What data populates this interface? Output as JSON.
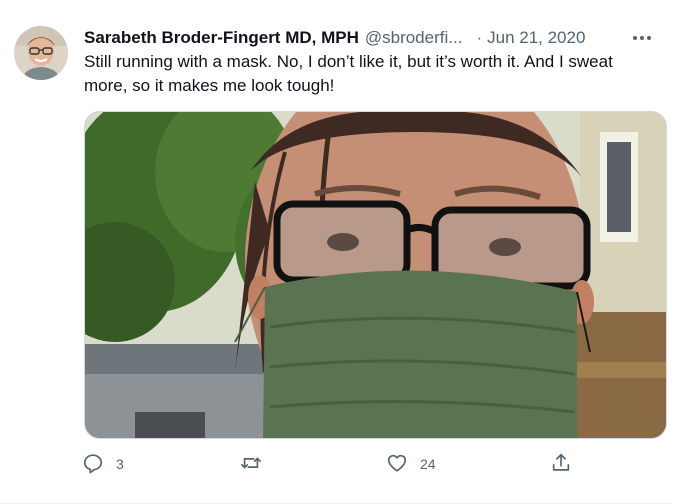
{
  "tweet": {
    "display_name": "Sarabeth Broder-Fingert MD, MPH",
    "handle": "@sbroderfi...",
    "separator": "·",
    "date": "Jun 21, 2020",
    "more": "•••",
    "text": "Still running with a mask. No, I don’t like it, but it’s worth it. And I sweat more, so it makes me look tough!"
  },
  "actions": {
    "reply_count": "3",
    "retweet_count": "",
    "like_count": "24"
  },
  "icons": {
    "avatar": "profile-photo",
    "reply": "reply-icon",
    "retweet": "retweet-icon",
    "like": "heart-icon",
    "share": "share-icon",
    "more": "more-icon"
  },
  "colors": {
    "text_primary": "#0f1419",
    "text_secondary": "#536471",
    "border": "#cfd9de"
  }
}
